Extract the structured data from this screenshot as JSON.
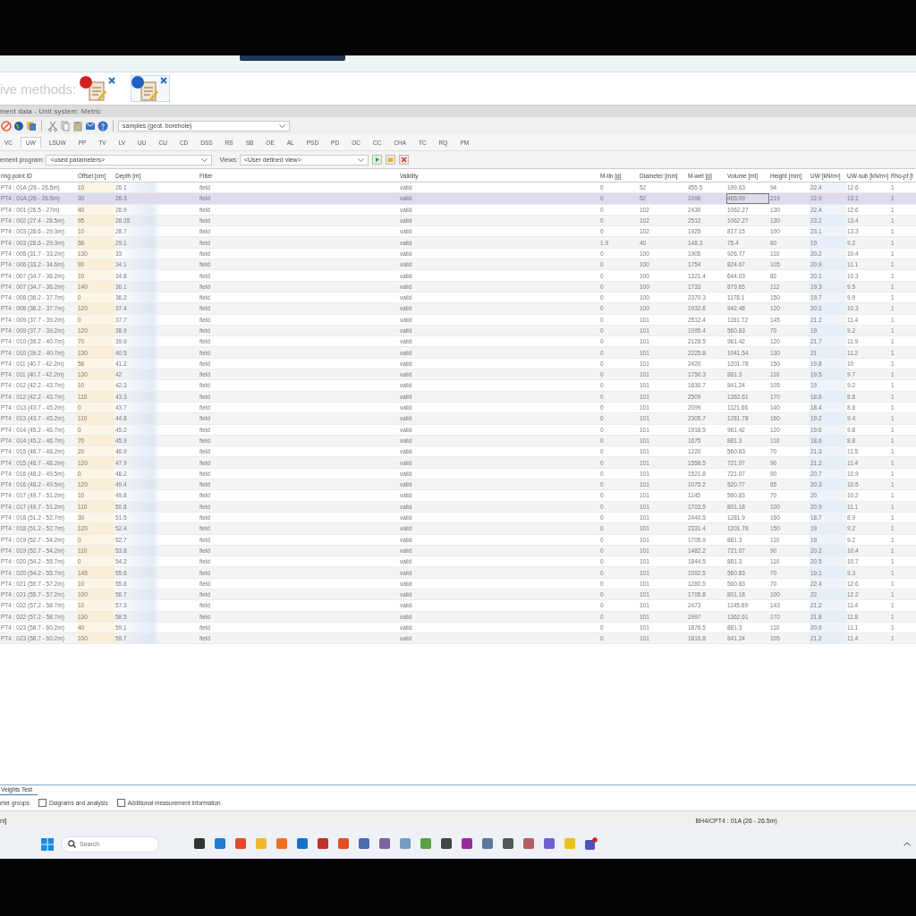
{
  "methods": {
    "label": "ive methods:",
    "items": [
      {
        "color": "#d42020",
        "selected": false
      },
      {
        "color": "#2060c0",
        "selected": true
      }
    ]
  },
  "title_bar": "ment data  -  Unit system: Metric",
  "toolbar": {
    "dropdown": "samples  (geot. borehole)"
  },
  "test_tabs": [
    {
      "label": "VC",
      "selected": false
    },
    {
      "label": "UW",
      "selected": true
    },
    {
      "label": "LSUW",
      "selected": false
    },
    {
      "label": "PP",
      "selected": false
    },
    {
      "label": "TV",
      "selected": false
    },
    {
      "label": "LV",
      "selected": false
    },
    {
      "label": "UU",
      "selected": false
    },
    {
      "label": "CU",
      "selected": false
    },
    {
      "label": "CD",
      "selected": false
    },
    {
      "label": "DSS",
      "selected": false
    },
    {
      "label": "RS",
      "selected": false
    },
    {
      "label": "SB",
      "selected": false
    },
    {
      "label": "OE",
      "selected": false
    },
    {
      "label": "AL",
      "selected": false
    },
    {
      "label": "PSD",
      "selected": false
    },
    {
      "label": "PD",
      "selected": false
    },
    {
      "label": "OC",
      "selected": false
    },
    {
      "label": "CC",
      "selected": false
    },
    {
      "label": "CHA",
      "selected": false
    },
    {
      "label": "TC",
      "selected": false
    },
    {
      "label": "RQ",
      "selected": false
    },
    {
      "label": "PM",
      "selected": false
    }
  ],
  "program": {
    "label": "ement program:",
    "value": "<used parameters>"
  },
  "views": {
    "label": "Views:",
    "value": "<User defined view>"
  },
  "table": {
    "columns": [
      "ring point ID",
      "Offset [cm]",
      "Depth [m]",
      "Filter",
      "Validity",
      "M-tin [g]",
      "Diameter [mm]",
      "M-wet [g]",
      "Volume [ml]",
      "Height [mm]",
      "UW [kN/m³]",
      "UW-sub [kN/m³]",
      "Rho-pf [t"
    ],
    "rows": [
      {
        "selected": false,
        "cells": [
          "PT4 : 01A (26 - 26.5m)",
          "10",
          "26.1",
          "field",
          "valid",
          "0",
          "52",
          "455.5",
          "199.63",
          "94",
          "22.4",
          "12.6",
          "1"
        ]
      },
      {
        "selected": true,
        "cells": [
          "PT4 : 01A (26 - 26.5m)",
          "30",
          "26.3",
          "field",
          "valid",
          "0",
          "52",
          "1096",
          "465.09",
          "219",
          "22.9",
          "13.1",
          "1"
        ]
      },
      {
        "selected": false,
        "cells": [
          "PT4 : 001 (26.5 - 27m)",
          "40",
          "26.9",
          "field",
          "valid",
          "0",
          "102",
          "2430",
          "1062.27",
          "130",
          "22.4",
          "12.6",
          "1"
        ]
      },
      {
        "selected": false,
        "cells": [
          "PT4 : 002 (27.4 - 28.5m)",
          "95",
          "28.35",
          "field",
          "valid",
          "0",
          "102",
          "2512",
          "1062.27",
          "130",
          "23.2",
          "13.4",
          "1"
        ]
      },
      {
        "selected": false,
        "cells": [
          "PT4 : 003 (28.6 - 29.3m)",
          "10",
          "28.7",
          "field",
          "valid",
          "0",
          "102",
          "1925",
          "817.15",
          "100",
          "23.1",
          "13.3",
          "1"
        ]
      },
      {
        "selected": false,
        "cells": [
          "PT4 : 003 (28.6 - 29.3m)",
          "56",
          "29.1",
          "field",
          "valid",
          "1.9",
          "40",
          "148.3",
          "75.4",
          "60",
          "19",
          "9.2",
          "1"
        ]
      },
      {
        "selected": false,
        "cells": [
          "PT4 : 005 (31.7 - 33.2m)",
          "130",
          "33",
          "field",
          "valid",
          "0",
          "100",
          "1905",
          "926.77",
          "110",
          "20.2",
          "10.4",
          "1"
        ]
      },
      {
        "selected": false,
        "cells": [
          "PT4 : 006 (33.2 - 34.6m)",
          "90",
          "34.1",
          "field",
          "valid",
          "0",
          "100",
          "1754",
          "824.67",
          "105",
          "20.9",
          "11.1",
          "1"
        ]
      },
      {
        "selected": false,
        "cells": [
          "PT4 : 007 (34.7 - 36.2m)",
          "10",
          "34.8",
          "field",
          "valid",
          "0",
          "100",
          "1321.4",
          "644.03",
          "82",
          "20.1",
          "10.3",
          "1"
        ]
      },
      {
        "selected": false,
        "cells": [
          "PT4 : 007 (34.7 - 36.2m)",
          "140",
          "36.1",
          "field",
          "valid",
          "0",
          "100",
          "1733",
          "879.65",
          "112",
          "19.3",
          "9.5",
          "1"
        ]
      },
      {
        "selected": false,
        "cells": [
          "PT4 : 008 (36.2 - 37.7m)",
          "0",
          "36.2",
          "field",
          "valid",
          "0",
          "100",
          "2370.3",
          "1178.1",
          "150",
          "19.7",
          "9.9",
          "1"
        ]
      },
      {
        "selected": false,
        "cells": [
          "PT4 : 008 (36.2 - 37.7m)",
          "120",
          "37.4",
          "field",
          "valid",
          "0",
          "100",
          "1932.8",
          "942.48",
          "120",
          "20.1",
          "10.3",
          "1"
        ]
      },
      {
        "selected": false,
        "cells": [
          "PT4 : 009 (37.7 - 39.2m)",
          "0",
          "37.7",
          "field",
          "valid",
          "0",
          "101",
          "2512.4",
          "1161.72",
          "145",
          "21.2",
          "11.4",
          "1"
        ]
      },
      {
        "selected": false,
        "cells": [
          "PT4 : 009 (37.7 - 39.2m)",
          "120",
          "38.9",
          "field",
          "valid",
          "0",
          "101",
          "1095.4",
          "560.83",
          "70",
          "19",
          "9.2",
          "1"
        ]
      },
      {
        "selected": false,
        "cells": [
          "PT4 : 010 (39.2 - 40.7m)",
          "70",
          "39.9",
          "field",
          "valid",
          "0",
          "101",
          "2128.5",
          "961.42",
          "120",
          "21.7",
          "11.9",
          "1"
        ]
      },
      {
        "selected": false,
        "cells": [
          "PT4 : 010 (39.2 - 40.7m)",
          "130",
          "40.5",
          "field",
          "valid",
          "0",
          "101",
          "2225.8",
          "1041.54",
          "130",
          "21",
          "11.2",
          "1"
        ]
      },
      {
        "selected": false,
        "cells": [
          "PT4 : 011 (40.7 - 42.2m)",
          "56",
          "41.2",
          "field",
          "valid",
          "0",
          "101",
          "2420",
          "1201.78",
          "150",
          "19.8",
          "10",
          "1"
        ]
      },
      {
        "selected": false,
        "cells": [
          "PT4 : 011 (40.7 - 42.2m)",
          "130",
          "42",
          "field",
          "valid",
          "0",
          "101",
          "1750.3",
          "881.3",
          "110",
          "19.5",
          "9.7",
          "1"
        ]
      },
      {
        "selected": false,
        "cells": [
          "PT4 : 012 (42.2 - 43.7m)",
          "10",
          "42.3",
          "field",
          "valid",
          "0",
          "101",
          "1630.7",
          "841.24",
          "105",
          "19",
          "9.2",
          "1"
        ]
      },
      {
        "selected": false,
        "cells": [
          "PT4 : 012 (42.2 - 43.7m)",
          "110",
          "43.3",
          "field",
          "valid",
          "0",
          "101",
          "2509",
          "1362.61",
          "170",
          "18.6",
          "8.8",
          "1"
        ]
      },
      {
        "selected": false,
        "cells": [
          "PT4 : 013 (43.7 - 45.2m)",
          "0",
          "43.7",
          "field",
          "valid",
          "0",
          "101",
          "2099",
          "1121.66",
          "140",
          "18.4",
          "8.6",
          "1"
        ]
      },
      {
        "selected": false,
        "cells": [
          "PT4 : 013 (43.7 - 45.2m)",
          "110",
          "44.8",
          "field",
          "valid",
          "0",
          "101",
          "2305.7",
          "1281.78",
          "160",
          "19.2",
          "9.4",
          "1"
        ]
      },
      {
        "selected": false,
        "cells": [
          "PT4 : 014 (45.2 - 46.7m)",
          "0",
          "45.2",
          "field",
          "valid",
          "0",
          "101",
          "1918.5",
          "961.42",
          "120",
          "19.6",
          "9.8",
          "1"
        ]
      },
      {
        "selected": false,
        "cells": [
          "PT4 : 014 (45.2 - 46.7m)",
          "70",
          "45.9",
          "field",
          "valid",
          "0",
          "101",
          "1675",
          "881.3",
          "110",
          "18.6",
          "8.8",
          "1"
        ]
      },
      {
        "selected": false,
        "cells": [
          "PT4 : 015 (46.7 - 48.2m)",
          "20",
          "46.9",
          "field",
          "valid",
          "0",
          "101",
          "1220",
          "560.83",
          "70",
          "21.3",
          "11.5",
          "1"
        ]
      },
      {
        "selected": false,
        "cells": [
          "PT4 : 015 (46.7 - 48.2m)",
          "120",
          "47.9",
          "field",
          "valid",
          "0",
          "101",
          "1558.5",
          "721.07",
          "90",
          "21.2",
          "11.4",
          "1"
        ]
      },
      {
        "selected": false,
        "cells": [
          "PT4 : 016 (48.2 - 49.5m)",
          "0",
          "48.2",
          "field",
          "valid",
          "0",
          "101",
          "1521.8",
          "721.07",
          "90",
          "20.7",
          "10.9",
          "1"
        ]
      },
      {
        "selected": false,
        "cells": [
          "PT4 : 016 (48.2 - 49.5m)",
          "120",
          "49.4",
          "field",
          "valid",
          "0",
          "101",
          "1075.2",
          "520.77",
          "65",
          "20.3",
          "10.5",
          "1"
        ]
      },
      {
        "selected": false,
        "cells": [
          "PT4 : 017 (49.7 - 51.2m)",
          "10",
          "49.8",
          "field",
          "valid",
          "0",
          "101",
          "1145",
          "560.83",
          "70",
          "20",
          "10.2",
          "1"
        ]
      },
      {
        "selected": false,
        "cells": [
          "PT4 : 017 (49.7 - 51.2m)",
          "110",
          "50.8",
          "field",
          "valid",
          "0",
          "101",
          "1703.5",
          "801.18",
          "100",
          "20.9",
          "11.1",
          "1"
        ]
      },
      {
        "selected": false,
        "cells": [
          "PT4 : 018 (51.2 - 52.7m)",
          "30",
          "51.5",
          "field",
          "valid",
          "0",
          "101",
          "2440.5",
          "1281.9",
          "160",
          "18.7",
          "8.9",
          "1"
        ]
      },
      {
        "selected": false,
        "cells": [
          "PT4 : 018 (51.2 - 52.7m)",
          "120",
          "52.4",
          "field",
          "valid",
          "0",
          "101",
          "2331.4",
          "1201.78",
          "150",
          "19",
          "9.2",
          "1"
        ]
      },
      {
        "selected": false,
        "cells": [
          "PT4 : 019 (52.7 - 54.2m)",
          "0",
          "52.7",
          "field",
          "valid",
          "0",
          "101",
          "1705.9",
          "881.3",
          "110",
          "19",
          "9.2",
          "1"
        ]
      },
      {
        "selected": false,
        "cells": [
          "PT4 : 019 (52.7 - 54.2m)",
          "110",
          "53.8",
          "field",
          "valid",
          "0",
          "101",
          "1482.2",
          "721.07",
          "90",
          "20.2",
          "10.4",
          "1"
        ]
      },
      {
        "selected": false,
        "cells": [
          "PT4 : 020 (54.2 - 55.7m)",
          "0",
          "54.2",
          "field",
          "valid",
          "0",
          "101",
          "1844.5",
          "881.3",
          "110",
          "20.5",
          "10.7",
          "1"
        ]
      },
      {
        "selected": false,
        "cells": [
          "PT4 : 020 (54.2 - 55.7m)",
          "145",
          "55.6",
          "field",
          "valid",
          "0",
          "101",
          "1092.5",
          "560.83",
          "70",
          "19.1",
          "9.3",
          "1"
        ]
      },
      {
        "selected": false,
        "cells": [
          "PT4 : 021 (55.7 - 57.2m)",
          "10",
          "55.8",
          "field",
          "valid",
          "0",
          "101",
          "1280.5",
          "560.83",
          "70",
          "22.4",
          "12.6",
          "1"
        ]
      },
      {
        "selected": false,
        "cells": [
          "PT4 : 021 (55.7 - 57.2m)",
          "100",
          "56.7",
          "field",
          "valid",
          "0",
          "101",
          "1795.8",
          "801.18",
          "100",
          "22",
          "12.2",
          "1"
        ]
      },
      {
        "selected": false,
        "cells": [
          "PT4 : 022 (57.2 - 58.7m)",
          "10",
          "57.3",
          "field",
          "valid",
          "0",
          "101",
          "2473",
          "1145.69",
          "143",
          "21.2",
          "11.4",
          "1"
        ]
      },
      {
        "selected": false,
        "cells": [
          "PT4 : 022 (57.2 - 58.7m)",
          "130",
          "58.5",
          "field",
          "valid",
          "0",
          "101",
          "2997",
          "1362.61",
          "170",
          "21.8",
          "11.8",
          "1"
        ]
      },
      {
        "selected": false,
        "cells": [
          "PT4 : 023 (58.7 - 60.2m)",
          "40",
          "59.1",
          "field",
          "valid",
          "0",
          "101",
          "1876.5",
          "881.3",
          "110",
          "20.9",
          "11.1",
          "1"
        ]
      },
      {
        "selected": false,
        "cells": [
          "PT4 : 023 (58.7 - 60.2m)",
          "100",
          "59.7",
          "field",
          "valid",
          "0",
          "101",
          "1816.8",
          "841.24",
          "105",
          "21.2",
          "11.4",
          "1"
        ]
      }
    ]
  },
  "bottom_tab": {
    "label": "Veights Test"
  },
  "options": {
    "label": "eter groups",
    "checkboxes": [
      {
        "label": "Diagrams and analysis",
        "checked": false
      },
      {
        "label": "Additional measurement information",
        "checked": false
      }
    ]
  },
  "status_bar": {
    "left": "nl]",
    "right": "BH4/CPT4 : 01A (26 - 26.5m)"
  },
  "taskbar": {
    "search_placeholder": "Search"
  }
}
